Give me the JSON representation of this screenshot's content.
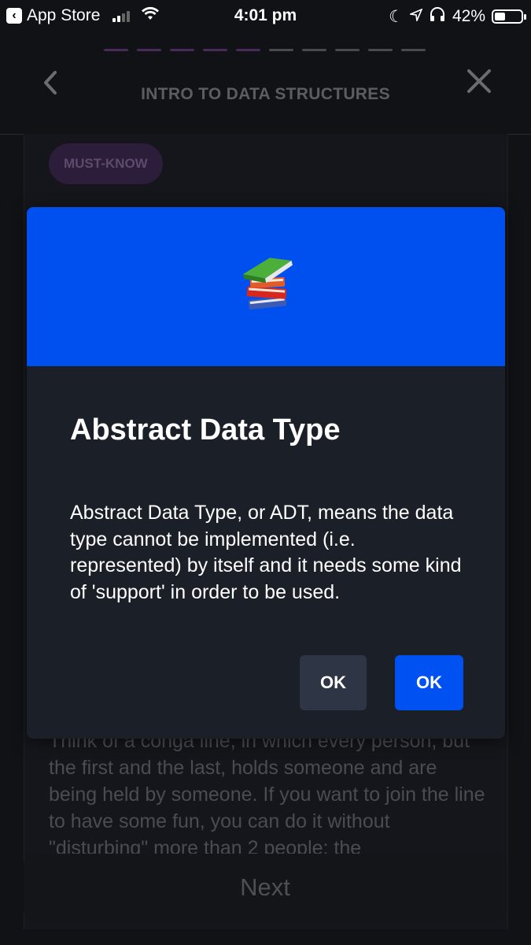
{
  "status_bar": {
    "back_app": "App Store",
    "time": "4:01 pm",
    "battery": "42%",
    "battery_level": 0.42
  },
  "progress": {
    "total_steps": 10,
    "completed_steps": 5
  },
  "header": {
    "title": "INTRO TO DATA STRUCTURES"
  },
  "card": {
    "tag": "MUST-KNOW",
    "text": "Think of a conga line, in which every person, but the first and the last, holds someone and are being held by someone. If you want to join the line to have some fun, you can do it without \"disturbing\" more than 2 people; the",
    "next_label": "Next"
  },
  "dialog": {
    "icon": "books-icon",
    "title": "Abstract Data Type",
    "body": "Abstract Data Type, or ADT, means the data type cannot be implemented (i.e. represented) by itself and it needs some kind of 'support' in order to be used.",
    "button_secondary": "OK",
    "button_primary": "OK"
  },
  "colors": {
    "dialog_header": "#0050f0",
    "primary_button": "#0051f2",
    "secondary_button": "#2e3646",
    "dialog_background": "#1b1f27"
  }
}
